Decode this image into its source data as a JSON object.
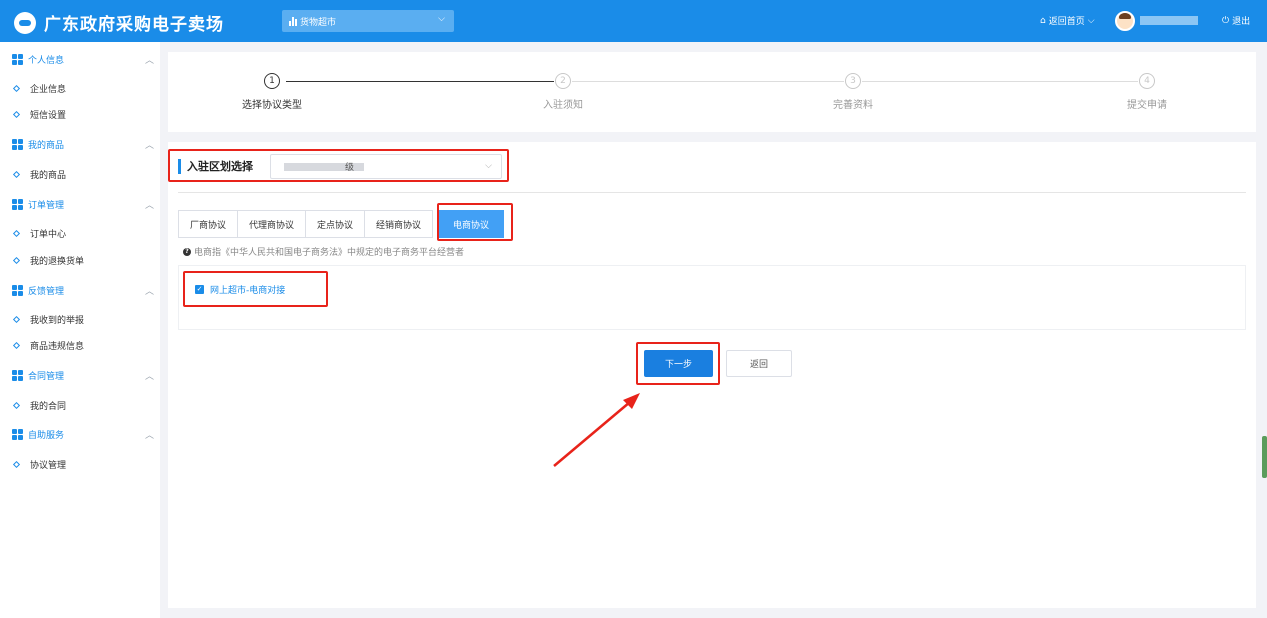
{
  "header": {
    "logo_text": "广东政府采购电子卖场",
    "mall_select_value": "货物超市",
    "home_link": "返回首页",
    "logout": "退出"
  },
  "sidebar": {
    "sections": [
      {
        "label": "个人信息",
        "items": [
          "企业信息",
          "短信设置"
        ]
      },
      {
        "label": "我的商品",
        "items": [
          "我的商品"
        ]
      },
      {
        "label": "订单管理",
        "items": [
          "订单中心",
          "我的退换货单"
        ]
      },
      {
        "label": "反馈管理",
        "items": [
          "我收到的举报",
          "商品违规信息"
        ]
      },
      {
        "label": "合同管理",
        "items": [
          "我的合同"
        ]
      },
      {
        "label": "自助服务",
        "items": [
          "协议管理"
        ]
      }
    ]
  },
  "steps": [
    {
      "num": "1",
      "label": "选择协议类型"
    },
    {
      "num": "2",
      "label": "入驻须知"
    },
    {
      "num": "3",
      "label": "完善资料"
    },
    {
      "num": "4",
      "label": "提交申请"
    }
  ],
  "region": {
    "title": "入驻区划选择",
    "value_suffix": "级"
  },
  "tabs": [
    "厂商协议",
    "代理商协议",
    "定点协议",
    "经销商协议",
    "电商协议"
  ],
  "hint": "电商指《中华人民共和国电子商务法》中规定的电子商务平台经营者",
  "option": "网上超市-电商对接",
  "buttons": {
    "next": "下一步",
    "back": "返回"
  },
  "colors": {
    "primary": "#1a8ce8",
    "highlight": "#e8231a"
  }
}
